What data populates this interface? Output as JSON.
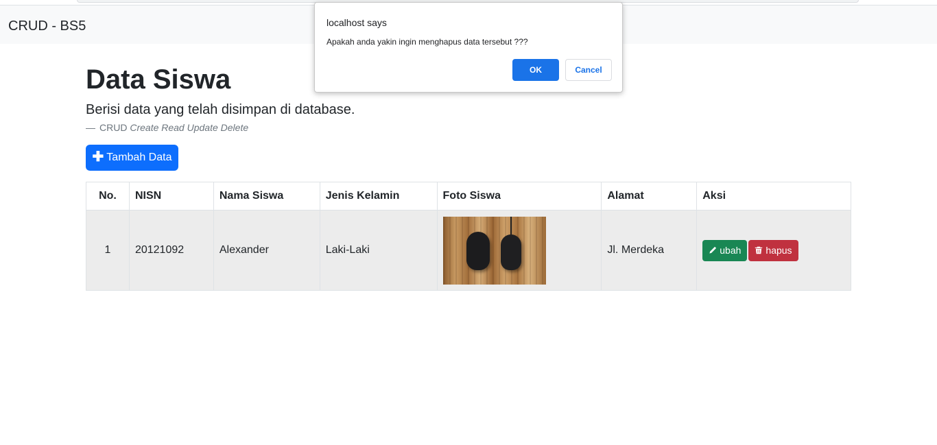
{
  "navbar": {
    "brand": "CRUD - BS5"
  },
  "page": {
    "title": "Data Siswa",
    "lead": "Berisi data yang telah disimpan di database.",
    "quote_prefix": "—",
    "quote_source": "CRUD",
    "quote_cite": "Create Read Update Delete",
    "add_button": "Tambah Data"
  },
  "table": {
    "headers": [
      "No.",
      "NISN",
      "Nama Siswa",
      "Jenis Kelamin",
      "Foto Siswa",
      "Alamat",
      "Aksi"
    ],
    "rows": [
      {
        "no": "1",
        "nisn": "20121092",
        "nama": "Alexander",
        "jk": "Laki-Laki",
        "alamat": "Jl. Merdeka",
        "edit_label": "ubah",
        "delete_label": "hapus"
      }
    ]
  },
  "dialog": {
    "title": "localhost says",
    "message": "Apakah anda yakin ingin menghapus data tersebut ???",
    "ok": "OK",
    "cancel": "Cancel"
  },
  "colors": {
    "primary": "#0d6efd",
    "success": "#198754",
    "danger": "#c0313f",
    "dialog_accent": "#1a73e8"
  },
  "icons": {
    "add": "plus-icon",
    "edit": "pencil-icon",
    "delete": "trash-icon"
  }
}
